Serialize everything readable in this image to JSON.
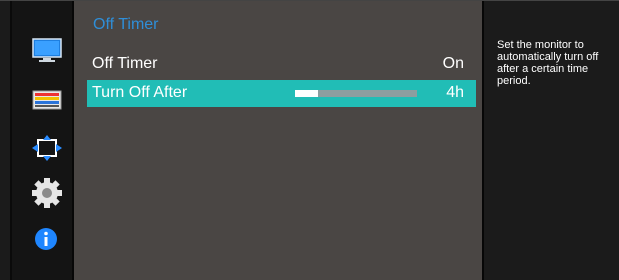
{
  "sidebar": {
    "icons": [
      {
        "name": "picture-icon"
      },
      {
        "name": "color-icon"
      },
      {
        "name": "position-icon"
      },
      {
        "name": "system-gear-icon"
      },
      {
        "name": "info-icon"
      }
    ]
  },
  "menu": {
    "title": "Off Timer",
    "items": [
      {
        "label": "Off Timer",
        "value": "On",
        "selected": false
      },
      {
        "label": "Turn Off After",
        "value": "4h",
        "selected": true,
        "slider_level": 0.19
      }
    ]
  },
  "help": {
    "text": "Set the monitor to automatically turn off after a certain time period."
  },
  "colors": {
    "accent_title": "#2f8ed8",
    "selected_row": "#21bdb6",
    "menu_bg": "#4a4644"
  }
}
